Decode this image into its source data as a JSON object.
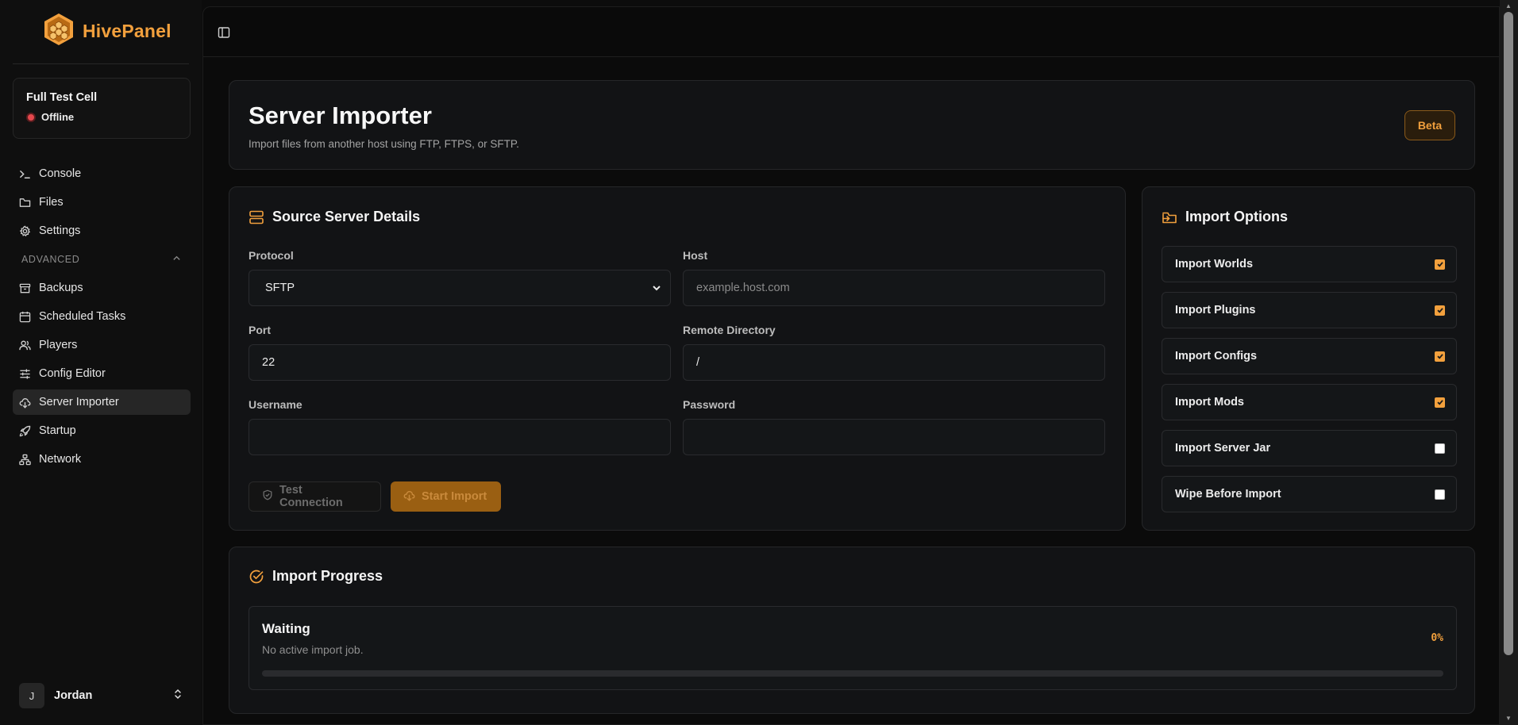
{
  "brand": {
    "name": "HivePanel",
    "accent": "#f2a03d"
  },
  "server": {
    "name": "Full Test Cell",
    "status": "Offline",
    "status_color": "#e5484d"
  },
  "nav": {
    "items_top": [
      {
        "label": "Console",
        "icon": "terminal-icon"
      },
      {
        "label": "Files",
        "icon": "folder-icon"
      },
      {
        "label": "Settings",
        "icon": "gear-icon"
      }
    ],
    "section_label": "ADVANCED",
    "items_advanced": [
      {
        "label": "Backups",
        "icon": "archive-icon"
      },
      {
        "label": "Scheduled Tasks",
        "icon": "calendar-icon"
      },
      {
        "label": "Players",
        "icon": "users-icon"
      },
      {
        "label": "Config Editor",
        "icon": "sliders-icon"
      },
      {
        "label": "Server Importer",
        "icon": "cloud-download-icon",
        "active": true
      },
      {
        "label": "Startup",
        "icon": "rocket-icon"
      },
      {
        "label": "Network",
        "icon": "network-icon"
      }
    ]
  },
  "user": {
    "initial": "J",
    "name": "Jordan"
  },
  "header": {
    "title": "Server Importer",
    "subtitle": "Import files from another host using FTP, FTPS, or SFTP.",
    "badge": "Beta"
  },
  "source": {
    "title": "Source Server Details",
    "protocol_label": "Protocol",
    "protocol_value": "SFTP",
    "host_label": "Host",
    "host_placeholder": "example.host.com",
    "port_label": "Port",
    "port_value": "22",
    "remote_dir_label": "Remote Directory",
    "remote_dir_value": "/",
    "username_label": "Username",
    "username_value": "",
    "password_label": "Password",
    "password_value": "",
    "test_button": "Test Connection",
    "start_button": "Start Import"
  },
  "options": {
    "title": "Import Options",
    "items": [
      {
        "label": "Import Worlds",
        "checked": true
      },
      {
        "label": "Import Plugins",
        "checked": true
      },
      {
        "label": "Import Configs",
        "checked": true
      },
      {
        "label": "Import Mods",
        "checked": true
      },
      {
        "label": "Import Server Jar",
        "checked": false
      },
      {
        "label": "Wipe Before Import",
        "checked": false
      }
    ]
  },
  "progress": {
    "title": "Import Progress",
    "status": "Waiting",
    "detail": "No active import job.",
    "percent_label": "0%",
    "fraction": 0
  }
}
